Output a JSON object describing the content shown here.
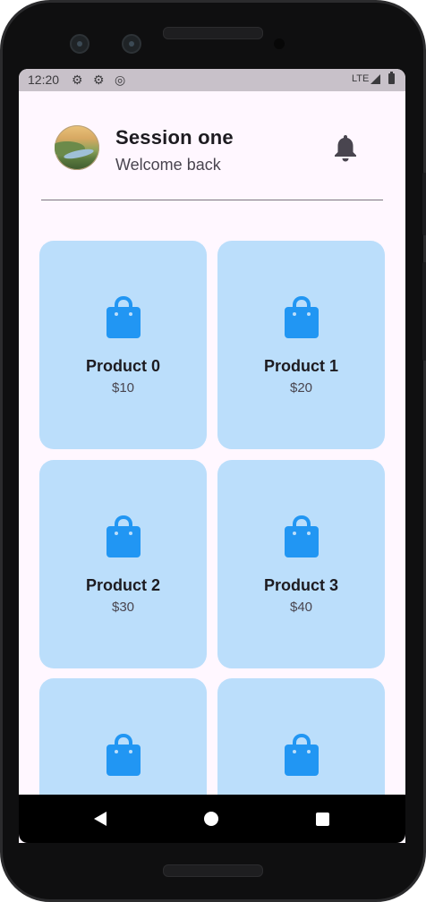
{
  "status_bar": {
    "time": "12:20",
    "network": "LTE",
    "icons": [
      "settings-icon",
      "settings-icon",
      "sync-icon",
      "signal-icon",
      "battery-icon"
    ]
  },
  "header": {
    "title": "Session one",
    "subtitle": "Welcome back",
    "avatar_icon": "landscape-avatar",
    "action_icon": "bell-icon"
  },
  "products": [
    {
      "name": "Product 0",
      "price": "$10",
      "icon": "shopping-bag-icon"
    },
    {
      "name": "Product 1",
      "price": "$20",
      "icon": "shopping-bag-icon"
    },
    {
      "name": "Product 2",
      "price": "$30",
      "icon": "shopping-bag-icon"
    },
    {
      "name": "Product 3",
      "price": "$40",
      "icon": "shopping-bag-icon"
    },
    {
      "name": "",
      "price": "",
      "icon": "shopping-bag-icon"
    },
    {
      "name": "",
      "price": "",
      "icon": "shopping-bag-icon"
    }
  ],
  "colors": {
    "background": "#fff7ff",
    "card": "#bbdefb",
    "accent": "#2196f3",
    "text_primary": "#1d1b20",
    "text_secondary": "#49454f"
  },
  "nav_bar": {
    "icons": [
      "back-icon",
      "home-icon",
      "recent-apps-icon"
    ]
  }
}
